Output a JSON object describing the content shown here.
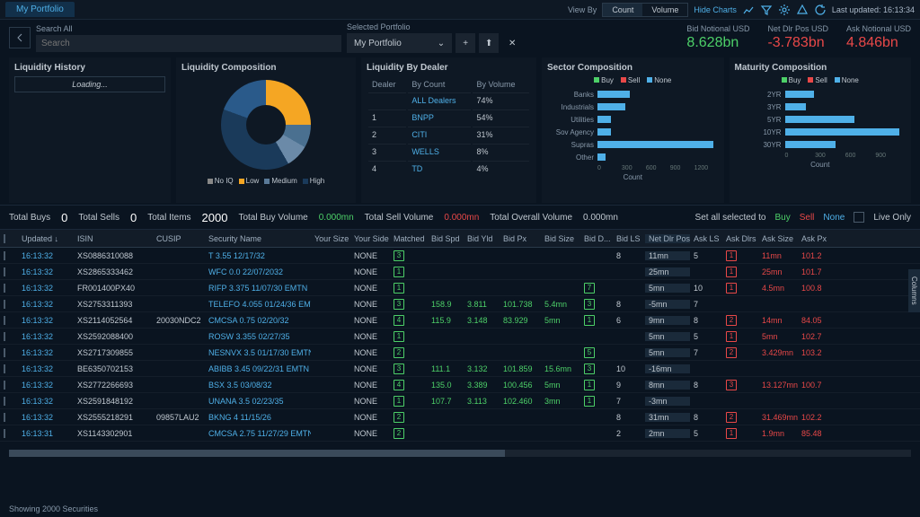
{
  "topbar": {
    "tab": "My Portfolio",
    "viewby": "View By",
    "count": "Count",
    "volume": "Volume",
    "hidechart": "Hide Charts",
    "lastupdated": "Last updated: 16:13:34"
  },
  "search": {
    "label": "Search All",
    "placeholder": "Search"
  },
  "portfolio": {
    "label": "Selected Portfolio",
    "value": "My Portfolio"
  },
  "stats": {
    "bid": {
      "label": "Bid Notional USD",
      "value": "8.628bn"
    },
    "net": {
      "label": "Net Dlr Pos USD",
      "value": "-3.783bn"
    },
    "ask": {
      "label": "Ask Notional USD",
      "value": "4.846bn"
    }
  },
  "panels": {
    "liquidity_history": {
      "title": "Liquidity History",
      "loading": "Loading..."
    },
    "liquidity_comp": {
      "title": "Liquidity Composition",
      "legend": [
        "No IQ",
        "Low",
        "Medium",
        "High"
      ]
    },
    "dealer": {
      "title": "Liquidity By Dealer",
      "cols": [
        "Dealer",
        "By Count",
        "By Volume"
      ],
      "rows": [
        {
          "n": "",
          "name": "ALL Dealers",
          "v": "74%"
        },
        {
          "n": "1",
          "name": "BNPP",
          "v": "54%"
        },
        {
          "n": "2",
          "name": "CITI",
          "v": "31%"
        },
        {
          "n": "3",
          "name": "WELLS",
          "v": "8%"
        },
        {
          "n": "4",
          "name": "TD",
          "v": "4%"
        }
      ]
    },
    "sector": {
      "title": "Sector Composition",
      "legend": [
        "Buy",
        "Sell",
        "None"
      ],
      "axislabel": "Count"
    },
    "maturity": {
      "title": "Maturity Composition",
      "legend": [
        "Buy",
        "Sell",
        "None"
      ],
      "axislabel": "Count"
    }
  },
  "chart_data": [
    {
      "type": "pie",
      "title": "Liquidity Composition",
      "categories": [
        "No IQ",
        "Low",
        "Medium",
        "High"
      ],
      "values": [
        25,
        8,
        8,
        59
      ],
      "colors": [
        "#888",
        "#f5a623",
        "#5a7a98",
        "#1a3a5a"
      ]
    },
    {
      "type": "bar",
      "title": "Sector Composition",
      "orientation": "horizontal",
      "categories": [
        "Banks",
        "Industrials",
        "Utilities",
        "Sov Agency",
        "Supras",
        "Other"
      ],
      "values": [
        320,
        280,
        130,
        130,
        1150,
        80
      ],
      "xlabel": "Count",
      "xlim": [
        0,
        1200
      ],
      "ticks": [
        0,
        300,
        600,
        900,
        1200
      ],
      "legend": [
        "Buy",
        "Sell",
        "None"
      ]
    },
    {
      "type": "bar",
      "title": "Maturity Composition",
      "orientation": "horizontal",
      "categories": [
        "2YR",
        "3YR",
        "5YR",
        "10YR",
        "30YR"
      ],
      "values": [
        220,
        160,
        520,
        850,
        380
      ],
      "xlabel": "Count",
      "xlim": [
        0,
        900
      ],
      "ticks": [
        0,
        300,
        600,
        900
      ],
      "legend": [
        "Buy",
        "Sell",
        "None"
      ]
    }
  ],
  "totals": {
    "buys_l": "Total Buys",
    "buys": "0",
    "sells_l": "Total Sells",
    "sells": "0",
    "items_l": "Total Items",
    "items": "2000",
    "bvol_l": "Total Buy Volume",
    "bvol": "0.000mn",
    "svol_l": "Total Sell Volume",
    "svol": "0.000mn",
    "ovol_l": "Total Overall Volume",
    "ovol": "0.000mn",
    "setall": "Set all selected to",
    "buy": "Buy",
    "sell": "Sell",
    "none": "None",
    "liveonly": "Live Only"
  },
  "columns": [
    "",
    "Updated ↓",
    "ISIN",
    "CUSIP",
    "Security Name",
    "Your Size",
    "Your Side",
    "Matched",
    "Bid Spd",
    "Bid Yld",
    "Bid Px",
    "Bid Size",
    "Bid D...",
    "Bid LS",
    "Net Dlr Pos...",
    "Ask LS",
    "Ask Dlrs",
    "Ask Size",
    "Ask Px"
  ],
  "rows": [
    {
      "upd": "16:13:32",
      "isin": "XS0886310088",
      "cusip": "",
      "name": "T 3.55 12/17/32",
      "side": "NONE",
      "mat": "3",
      "bsp": "",
      "byl": "",
      "bpx": "",
      "bsz": "",
      "bd": "",
      "bls": "8",
      "net": "11mn",
      "als": "5",
      "ad": "1",
      "asz": "11mn",
      "apx": "101.2"
    },
    {
      "upd": "16:13:32",
      "isin": "XS2865333462",
      "cusip": "",
      "name": "WFC 0.0 22/07/2032",
      "side": "NONE",
      "mat": "1",
      "bsp": "",
      "byl": "",
      "bpx": "",
      "bsz": "",
      "bd": "",
      "bls": "",
      "net": "25mn",
      "als": "",
      "ad": "1",
      "asz": "25mn",
      "apx": "101.7"
    },
    {
      "upd": "16:13:32",
      "isin": "FR001400PX40",
      "cusip": "",
      "name": "RIFP 3.375 11/07/30 EMTN",
      "side": "NONE",
      "mat": "1",
      "bsp": "",
      "byl": "",
      "bpx": "",
      "bsz": "",
      "bd": "7",
      "bls": "",
      "net": "5mn",
      "als": "10",
      "ad": "1",
      "asz": "4.5mn",
      "apx": "100.8"
    },
    {
      "upd": "16:13:32",
      "isin": "XS2753311393",
      "cusip": "",
      "name": "TELEFO 4.055 01/24/36 EMTN",
      "side": "NONE",
      "mat": "3",
      "bsp": "158.9",
      "byl": "3.811",
      "bpx": "101.738",
      "bsz": "5.4mn",
      "bd": "3",
      "bls": "8",
      "net": "-5mn",
      "als": "7",
      "ad": "",
      "asz": "",
      "apx": ""
    },
    {
      "upd": "16:13:32",
      "isin": "XS2114052564",
      "cusip": "20030NDC2",
      "name": "CMCSA 0.75 02/20/32",
      "side": "NONE",
      "mat": "4",
      "bsp": "115.9",
      "byl": "3.148",
      "bpx": "83.929",
      "bsz": "5mn",
      "bd": "1",
      "bls": "6",
      "net": "9mn",
      "als": "8",
      "ad": "2",
      "asz": "14mn",
      "apx": "84.05"
    },
    {
      "upd": "16:13:32",
      "isin": "XS2592088400",
      "cusip": "",
      "name": "ROSW 3.355 02/27/35",
      "side": "NONE",
      "mat": "1",
      "bsp": "",
      "byl": "",
      "bpx": "",
      "bsz": "",
      "bd": "",
      "bls": "",
      "net": "5mn",
      "als": "5",
      "ad": "1",
      "asz": "5mn",
      "apx": "102.7"
    },
    {
      "upd": "16:13:32",
      "isin": "XS2717309855",
      "cusip": "",
      "name": "NESNVX 3.5 01/17/30 EMTN",
      "side": "NONE",
      "mat": "2",
      "bsp": "",
      "byl": "",
      "bpx": "",
      "bsz": "",
      "bd": "5",
      "bls": "",
      "net": "5mn",
      "als": "7",
      "ad": "2",
      "asz": "3.429mn",
      "apx": "103.2"
    },
    {
      "upd": "16:13:32",
      "isin": "BE6350702153",
      "cusip": "",
      "name": "ABIBB 3.45 09/22/31 EMTN",
      "side": "NONE",
      "mat": "3",
      "bsp": "111.1",
      "byl": "3.132",
      "bpx": "101.859",
      "bsz": "15.6mn",
      "bd": "3",
      "bls": "10",
      "net": "-16mn",
      "als": "",
      "ad": "",
      "asz": "",
      "apx": ""
    },
    {
      "upd": "16:13:32",
      "isin": "XS2772266693",
      "cusip": "",
      "name": "BSX 3.5 03/08/32",
      "side": "NONE",
      "mat": "4",
      "bsp": "135.0",
      "byl": "3.389",
      "bpx": "100.456",
      "bsz": "5mn",
      "bd": "1",
      "bls": "9",
      "net": "8mn",
      "als": "8",
      "ad": "3",
      "asz": "13.127mn",
      "apx": "100.7"
    },
    {
      "upd": "16:13:32",
      "isin": "XS2591848192",
      "cusip": "",
      "name": "UNANA 3.5 02/23/35",
      "side": "NONE",
      "mat": "1",
      "bsp": "107.7",
      "byl": "3.113",
      "bpx": "102.460",
      "bsz": "3mn",
      "bd": "1",
      "bls": "7",
      "net": "-3mn",
      "als": "",
      "ad": "",
      "asz": "",
      "apx": ""
    },
    {
      "upd": "16:13:32",
      "isin": "XS2555218291",
      "cusip": "09857LAU2",
      "name": "BKNG 4 11/15/26",
      "side": "NONE",
      "mat": "2",
      "bsp": "",
      "byl": "",
      "bpx": "",
      "bsz": "",
      "bd": "",
      "bls": "8",
      "net": "31mn",
      "als": "8",
      "ad": "2",
      "asz": "31.469mn",
      "apx": "102.2"
    },
    {
      "upd": "16:13:31",
      "isin": "XS1143302901",
      "cusip": "",
      "name": "CMCSA 2.75 11/27/29 EMTN",
      "side": "NONE",
      "mat": "2",
      "bsp": "",
      "byl": "",
      "bpx": "",
      "bsz": "",
      "bd": "",
      "bls": "2",
      "net": "2mn",
      "als": "5",
      "ad": "1",
      "asz": "1.9mn",
      "apx": "85.48"
    }
  ],
  "footer": "Showing 2000 Securities",
  "columnstab": "Columns"
}
